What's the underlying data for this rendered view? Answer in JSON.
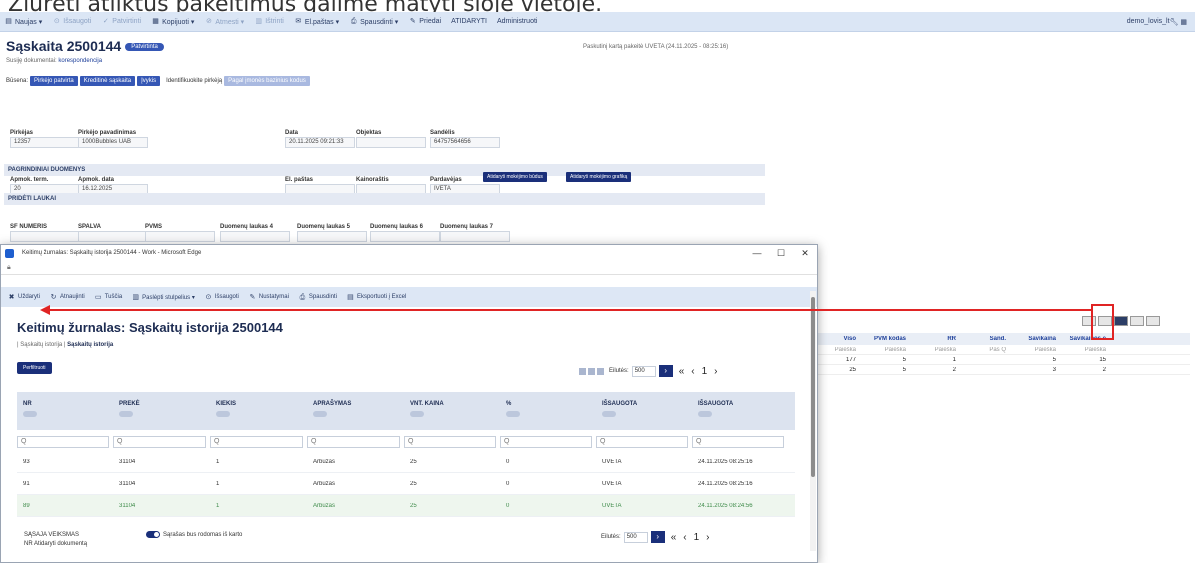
{
  "caption": "Žiūrėti atliktus pakeitimus galime matyti šioje vietoje.",
  "toolbar": {
    "items": [
      {
        "icon": "doc-icon",
        "label": "Naujas ▾",
        "dim": false
      },
      {
        "icon": "save-icon",
        "label": "Išsaugoti",
        "dim": true
      },
      {
        "icon": "check-icon",
        "label": "Patvirtinti",
        "dim": true
      },
      {
        "icon": "copy-icon",
        "label": "Kopijuoti ▾",
        "dim": false
      },
      {
        "icon": "cancel-icon",
        "label": "Atmesti ▾",
        "dim": true
      },
      {
        "icon": "trash-icon",
        "label": "Ištrinti",
        "dim": true
      },
      {
        "icon": "mail-icon",
        "label": "El.paštas ▾",
        "dim": false
      },
      {
        "icon": "print-icon",
        "label": "Spausdinti ▾",
        "dim": false
      },
      {
        "icon": "attach-icon",
        "label": "Priedai",
        "dim": false
      },
      {
        "icon": "",
        "label": "ATIDARYTI",
        "dim": false
      },
      {
        "icon": "",
        "label": "Administruoti",
        "dim": false
      }
    ],
    "user": "demo_lovis_lt"
  },
  "page": {
    "title": "Sąskaita 2500144",
    "status_pill": "Patvirtinta",
    "last_edit": "Paskutinį kartą pakeitė UVETA (24.11.2025 - 08:25:16)",
    "doc_link_prefix": "Susiję dokumentai:",
    "doc_link": "korespondencija",
    "status_label": "Būsena:",
    "status_buttons": [
      "Pirkėjo patvirta",
      "Kreditinė sąskaita",
      "Įvykis"
    ],
    "ident_label": "Identifikuokite pirkėją",
    "ident_btn": "Pagal įmonės bazinius kodus",
    "fields_row1": [
      {
        "label": "Pirkėjas",
        "value": "12357"
      },
      {
        "label": "Pirkėjo pavadinimas",
        "value": "1000Bubbles UAB"
      },
      {
        "label": "Data",
        "value": "20.11.2025 09:21:33"
      },
      {
        "label": "Objektas",
        "value": ""
      },
      {
        "label": "Sandėlis",
        "value": "64757564656"
      }
    ],
    "section_main": "PAGRINDINIAI DUOMENYS",
    "fields_row2": [
      {
        "label": "Apmok. term.",
        "value": "20"
      },
      {
        "label": "Apmok. data",
        "value": "16.12.2025"
      },
      {
        "label": "El. paštas",
        "value": ""
      },
      {
        "label": "Kainoraštis",
        "value": ""
      },
      {
        "label": "Pardavėjas",
        "value": "IVETA"
      }
    ],
    "btn_pay_terms": "Atidaryti mokėjimo būdus",
    "btn_pay_schedule": "Atidaryti mokėjimo grafiką",
    "section_extra": "PRIDĖTI LAUKAI",
    "fields_row3": [
      "SF NUMERIS",
      "SPALVA",
      "PVMS",
      "Duomenų laukas 4",
      "Duomenų laukas 5",
      "Duomenų laukas 6",
      "Duomenų laukas 7"
    ]
  },
  "bg_table": {
    "headers": [
      "Viso",
      "PVM kodas",
      "RR",
      "Sand.",
      "Savikaina",
      "Savikainos e"
    ],
    "placeholders": [
      "Paieška",
      "Paieška",
      "Paieška",
      "Pas Q",
      "Paieška",
      "Paieška"
    ],
    "rows": [
      [
        "177",
        "5",
        "1",
        "",
        "5",
        "15"
      ],
      [
        "25",
        "5",
        "2",
        "",
        "3",
        "2"
      ]
    ]
  },
  "window": {
    "title": "Keitimų žurnalas: Sąskaitų istorija 2500144 - Work - Microsoft Edge",
    "controls": [
      "—",
      "☐",
      "✕"
    ],
    "toolbar": [
      {
        "icon": "close-icon",
        "label": "Uždaryti"
      },
      {
        "icon": "refresh-icon",
        "label": "Atnaujinti"
      },
      {
        "icon": "clear-icon",
        "label": "Tuščia"
      },
      {
        "icon": "columns-icon",
        "label": "Paslėpti stulpelius ▾"
      },
      {
        "icon": "save-icon",
        "label": "Išsaugoti"
      },
      {
        "icon": "settings-icon",
        "label": "Nustatymai"
      },
      {
        "icon": "print-icon",
        "label": "Spausdinti"
      },
      {
        "icon": "excel-icon",
        "label": "Eksportuoti į Excel"
      }
    ],
    "heading": "Keitimų žurnalas: Sąskaitų istorija 2500144",
    "crumb_a": "Sąskaitų istorija",
    "crumb_b": "Sąskaitų istorija",
    "filter_btn": "Perfiltruoti",
    "per_page_label": "Eilutės:",
    "per_page": "500",
    "columns": [
      "NR",
      "PREKĖ",
      "KIEKIS",
      "APRAŠYMAS",
      "VNT. KAINA",
      "%",
      "IŠSAUGOTA",
      "IŠSAUGOTA"
    ],
    "filter_placeholder": "Q",
    "rows": [
      [
        "93",
        "31104",
        "1",
        "Arbuzas",
        "25",
        "0",
        "UVETA",
        "24.11.2025 08:25:16"
      ],
      [
        "91",
        "31104",
        "1",
        "Arbuzas",
        "25",
        "0",
        "UVETA",
        "24.11.2025 08:25:16"
      ],
      [
        "89",
        "31104",
        "1",
        "Arbuzas",
        "25",
        "0",
        "UVETA",
        "24.11.2025 08:24:56"
      ]
    ],
    "footer_a": "SĄSAJA VEIKSMAS",
    "footer_b": "NR   Atidaryti dokumentą",
    "toggle_label": "Sąrašas bus rodomas iš karto"
  }
}
